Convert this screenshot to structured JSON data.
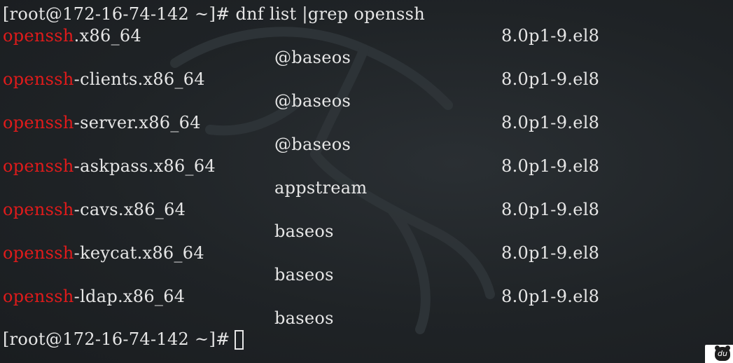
{
  "prompt": {
    "first": "[root@172-16-74-142 ~]# ",
    "command": "dnf list |grep openssh",
    "last": "[root@172-16-74-142 ~]#"
  },
  "highlight": "openssh",
  "packages": [
    {
      "suffix": ".x86_64",
      "version": "8.0p1-9.el8",
      "repo": "@baseos"
    },
    {
      "suffix": "-clients.x86_64",
      "version": "8.0p1-9.el8",
      "repo": "@baseos"
    },
    {
      "suffix": "-server.x86_64",
      "version": "8.0p1-9.el8",
      "repo": "@baseos"
    },
    {
      "suffix": "-askpass.x86_64",
      "version": "8.0p1-9.el8",
      "repo": "appstream"
    },
    {
      "suffix": "-cavs.x86_64",
      "version": "8.0p1-9.el8",
      "repo": "baseos"
    },
    {
      "suffix": "-keycat.x86_64",
      "version": "8.0p1-9.el8",
      "repo": "baseos"
    },
    {
      "suffix": "-ldap.x86_64",
      "version": "8.0p1-9.el8",
      "repo": "baseos"
    }
  ],
  "colors": {
    "background": "#1f2326",
    "text": "#e6e6e6",
    "highlight": "#e01b1b"
  },
  "badge": {
    "text": "du",
    "icon": "baidu-paw-icon"
  }
}
